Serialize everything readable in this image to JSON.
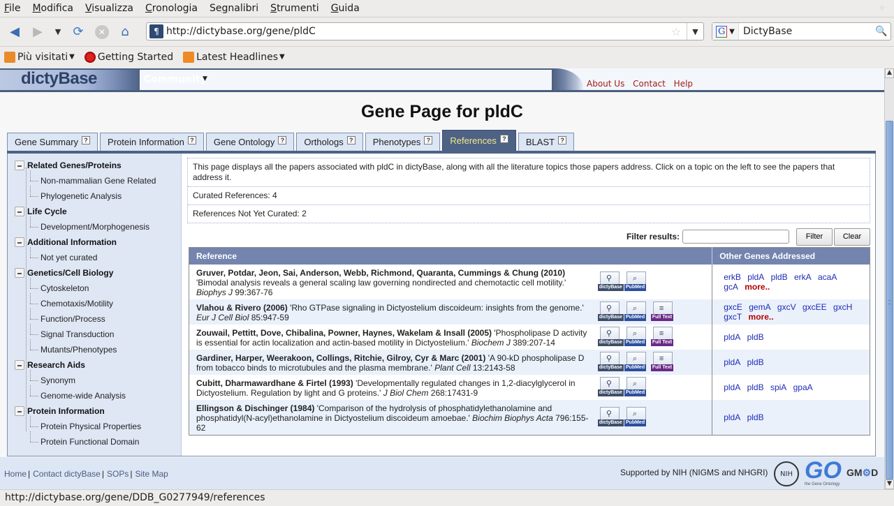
{
  "browser": {
    "menu": [
      {
        "label": "File",
        "accel": "F"
      },
      {
        "label": "Modifica",
        "accel": "M"
      },
      {
        "label": "Visualizza",
        "accel": "V"
      },
      {
        "label": "Cronologia",
        "accel": "C"
      },
      {
        "label": "Segnalibri",
        "accel": "g"
      },
      {
        "label": "Strumenti",
        "accel": "S"
      },
      {
        "label": "Guida",
        "accel": "G"
      }
    ],
    "url": "http://dictybase.org/gene/pldC",
    "search_value": "DictyBase",
    "search_engine_icon": "google-icon",
    "bookmarks": [
      {
        "label": "Più visitati",
        "icon": "folder-icon",
        "has_menu": true
      },
      {
        "label": "Getting Started",
        "icon": "firefox-icon",
        "has_menu": false
      },
      {
        "label": "Latest Headlines",
        "icon": "rss-icon",
        "has_menu": true
      }
    ],
    "status_text": "http://dictybase.org/gene/DDB_G0277949/references"
  },
  "site": {
    "logo": "dictyBase",
    "community_menu": "Community",
    "toplinks": [
      "About Us",
      "Contact",
      "Help"
    ],
    "page_title": "Gene Page for pldC",
    "tabs": [
      {
        "label": "Gene Summary",
        "active": false
      },
      {
        "label": "Protein Information",
        "active": false
      },
      {
        "label": "Gene Ontology",
        "active": false
      },
      {
        "label": "Orthologs",
        "active": false
      },
      {
        "label": "Phenotypes",
        "active": false
      },
      {
        "label": "References",
        "active": true
      },
      {
        "label": "BLAST",
        "active": false
      }
    ],
    "help_glyph": "?"
  },
  "sidebar": {
    "groups": [
      {
        "label": "Related Genes/Proteins",
        "children": [
          "Non-mammalian Gene Related",
          "Phylogenetic Analysis"
        ]
      },
      {
        "label": "Life Cycle",
        "children": [
          "Development/Morphogenesis"
        ]
      },
      {
        "label": "Additional Information",
        "children": [
          "Not yet curated"
        ]
      },
      {
        "label": "Genetics/Cell Biology",
        "children": [
          "Cytoskeleton",
          "Chemotaxis/Motility",
          "Function/Process",
          "Signal Transduction",
          "Mutants/Phenotypes"
        ]
      },
      {
        "label": "Research Aids",
        "children": [
          "Synonym",
          "Genome-wide Analysis"
        ]
      },
      {
        "label": "Protein Information",
        "children": [
          "Protein Physical Properties",
          "Protein Functional Domain"
        ]
      }
    ]
  },
  "main": {
    "intro": "This page displays all the papers associated with pldC in dictyBase, along with all the literature topics those papers address. Click on a topic on the left to see the papers that address it.",
    "curated": "Curated References: 4",
    "not_curated": "References Not Yet Curated: 2",
    "filter_label": "Filter results:",
    "filter_value": "",
    "filter_button": "Filter",
    "clear_button": "Clear",
    "table": {
      "headers": [
        "Reference",
        "Other Genes Addressed"
      ],
      "link_labels": {
        "dictybase": "dictyBase",
        "pubmed": "PubMed",
        "fulltext": "Full Text"
      },
      "more_label": "more..",
      "rows": [
        {
          "authors": "Gruver, Potdar, Jeon, Sai, Anderson, Webb, Richmond, Quaranta, Cummings & Chung (2010)",
          "title": "'Bimodal analysis reveals a general scaling law governing nondirected and chemotactic cell motility.'",
          "journal": "Biophys J",
          "pages": "99:367-76",
          "links": [
            "dictybase",
            "pubmed"
          ],
          "genes": [
            "erkB",
            "pldA",
            "pldB",
            "erkA",
            "acaA",
            "gcA"
          ],
          "more": true
        },
        {
          "authors": "Vlahou & Rivero (2006)",
          "title": "'Rho GTPase signaling in Dictyostelium discoideum: insights from the genome.'",
          "journal": "Eur J Cell Biol",
          "pages": "85:947-59",
          "links": [
            "dictybase",
            "pubmed",
            "fulltext"
          ],
          "genes": [
            "gxcE",
            "gemA",
            "gxcV",
            "gxcEE",
            "gxcH",
            "gxcT"
          ],
          "more": true
        },
        {
          "authors": "Zouwail, Pettitt, Dove, Chibalina, Powner, Haynes, Wakelam & Insall (2005)",
          "title": "'Phospholipase D activity is essential for actin localization and actin-based motility in Dictyostelium.'",
          "journal": "Biochem J",
          "pages": "389:207-14",
          "links": [
            "dictybase",
            "pubmed",
            "fulltext"
          ],
          "genes": [
            "pldA",
            "pldB"
          ],
          "more": false
        },
        {
          "authors": "Gardiner, Harper, Weerakoon, Collings, Ritchie, Gilroy, Cyr & Marc (2001)",
          "title": "'A 90-kD phospholipase D from tobacco binds to microtubules and the plasma membrane.'",
          "journal": "Plant Cell",
          "pages": "13:2143-58",
          "links": [
            "dictybase",
            "pubmed",
            "fulltext"
          ],
          "genes": [
            "pldA",
            "pldB"
          ],
          "more": false
        },
        {
          "authors": "Cubitt, Dharmawardhane & Firtel (1993)",
          "title": "'Developmentally regulated changes in 1,2-diacylglycerol in Dictyostelium. Regulation by light and G proteins.'",
          "journal": "J Biol Chem",
          "pages": "268:17431-9",
          "links": [
            "dictybase",
            "pubmed"
          ],
          "genes": [
            "pldA",
            "pldB",
            "spiA",
            "gpaA"
          ],
          "more": false
        },
        {
          "authors": "Ellingson & Dischinger (1984)",
          "title": "'Comparison of the hydrolysis of phosphatidylethanolamine and phosphatidyl(N-acyl)ethanolamine in Dictyostelium discoideum amoebae.'",
          "journal": "Biochim Biophys Acta",
          "pages": "796:155-62",
          "links": [
            "dictybase",
            "pubmed"
          ],
          "genes": [
            "pldA",
            "pldB"
          ],
          "more": false
        }
      ]
    }
  },
  "footer": {
    "links": [
      "Home",
      "Contact dictyBase",
      "SOPs",
      "Site Map"
    ],
    "support": "Supported by NIH (NIGMS and NHGRI)",
    "logos": {
      "nih": "NIH",
      "go": "GO",
      "go_caption": "the Gene Ontology",
      "gmod_prefix": "GM",
      "gmod_suffix": "D"
    }
  },
  "colors": {
    "header_blue": "#4d6284",
    "table_header": "#7384ae",
    "active_tab_text": "#f5e88a",
    "gene_link": "#1f2bb5",
    "more_link": "#b30000",
    "toplink": "#a11c1c"
  }
}
